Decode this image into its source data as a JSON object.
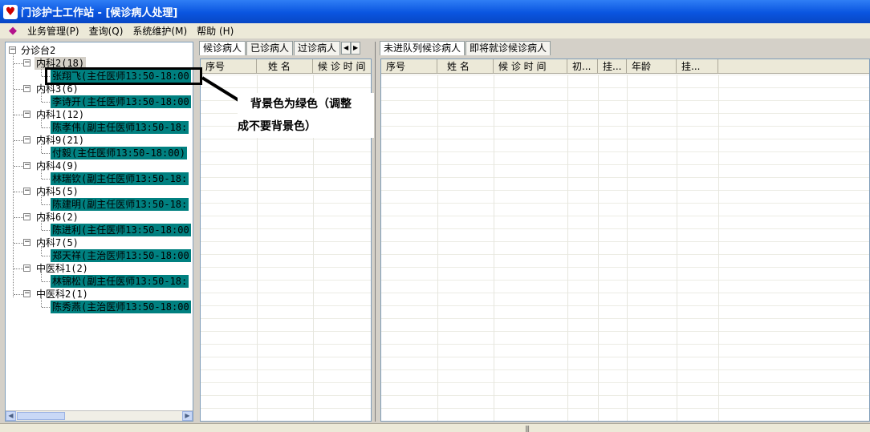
{
  "window": {
    "title": "门诊护士工作站 - [候诊病人处理]"
  },
  "menu": {
    "items": [
      "业务管理(P)",
      "查询(Q)",
      "系统维护(M)",
      "帮助 (H)"
    ]
  },
  "tree": {
    "root": "分诊台2",
    "groups": [
      {
        "label": "内科2(18)",
        "doctor": "张翔飞(主任医师13:50-18:00"
      },
      {
        "label": "内科3(6)",
        "doctor": "李诗开(主任医师13:50-18:00"
      },
      {
        "label": "内科1(12)",
        "doctor": "陈孝伟(副主任医师13:50-18:"
      },
      {
        "label": "内科9(21)",
        "doctor": "付毅(主任医师13:50-18:00)"
      },
      {
        "label": "内科4(9)",
        "doctor": "林瑞钦(副主任医师13:50-18:"
      },
      {
        "label": "内科5(5)",
        "doctor": "陈建明(副主任医师13:50-18:"
      },
      {
        "label": "内科6(2)",
        "doctor": "陈进利(主任医师13:50-18:00"
      },
      {
        "label": "内科7(5)",
        "doctor": "郑天祥(主治医师13:50-18:00"
      },
      {
        "label": "中医科1(2)",
        "doctor": "林锦松(副主任医师13:50-18:"
      },
      {
        "label": "中医科2(1)",
        "doctor": "陈秀燕(主治医师13:50-18:00"
      }
    ]
  },
  "left_tabs": [
    "候诊病人",
    "已诊病人",
    "过诊病人"
  ],
  "left_grid": {
    "columns": [
      "序号",
      "姓 名",
      "候 诊 时 间"
    ]
  },
  "right_tabs": [
    "未进队列候诊病人",
    "即将就诊候诊病人"
  ],
  "right_grid": {
    "columns": [
      "序号",
      "姓 名",
      "候 诊 时 间",
      "初...",
      "挂...",
      "年龄",
      "挂..."
    ]
  },
  "annotation": {
    "line1": "背景色为绿色（调整",
    "line2": "成不要背景色）"
  },
  "colors": {
    "doctor_bg": "#008080",
    "title_bar": "#0a55e0"
  }
}
